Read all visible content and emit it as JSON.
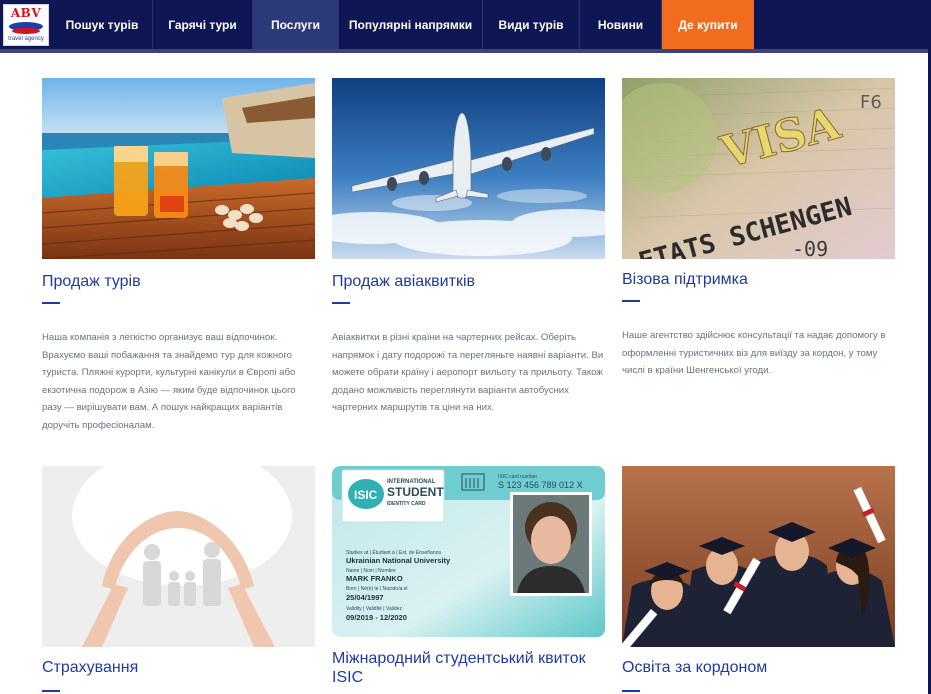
{
  "logo": {
    "text": "ABV",
    "subtext": "travel agency"
  },
  "nav": {
    "items": [
      {
        "label": "Пошук турів"
      },
      {
        "label": "Гарячі тури"
      },
      {
        "label": "Послуги"
      },
      {
        "label": "Популярні напрямки"
      },
      {
        "label": "Види турів"
      },
      {
        "label": "Новини"
      },
      {
        "label": "Де купити"
      }
    ]
  },
  "cards": [
    {
      "title": "Продаж турів",
      "description": "Наша компанія з легкістю организує ваш відпочинок. Врахуємо ваші побажання та знайдемо тур для кожного туриста. Пляжні курорти, культурні канікули в Європі або екзотична подорож в Азію — яким буде відпочинок цього разу — вирішувати вам. А пошук найкращих варіантів доручіть професіоналам."
    },
    {
      "title": "Продаж авіаквитків",
      "description": "Авіаквитки в різні країни на чартерних рейсах. Оберіть напрямок і дату подорожі та перегляньте наявні варіанти. Ви можете обрати країну і аеропорт вильоту та прильоту. Також додано можливість переглянути варіанти автобусних чартерних маршрутів та ціни на них."
    },
    {
      "title": "Візова підтримка",
      "description": "Наше агентство здійснює консультації та надає допомогу в оформленні туристичних віз для виїзду за кордон, у тому числі в країни Шенгенської угоди."
    },
    {
      "title": "Страхування"
    },
    {
      "title": "Міжнародний студентський квиток",
      "subtitle": "ISIC"
    },
    {
      "title": "Освіта за кордоном"
    }
  ],
  "visa_image": {
    "line1": "VISA",
    "line2": "ETATS SCHENGEN",
    "line3": "-09",
    "corner": "F6"
  },
  "isic_card": {
    "badge": "ISIC",
    "brand_line1": "INTERNATIONAL",
    "brand_line2": "STUDENT",
    "brand_line3": "IDENTITY CARD",
    "card_number_label": "ISIC card number",
    "card_number": "S 123 456 789 012 X",
    "studies_label": "Studies at | Étudiant à | Est. de Enseñanza",
    "university": "Ukrainian National University",
    "name_label": "Name | Nom | Nombre",
    "name": "MARK FRANKO",
    "born_label": "Born | Né(e) le | Nacido/a el",
    "born": "25/04/1997",
    "validity_label": "Validity | Validité | Validez",
    "validity": "09/2019 - 12/2020"
  },
  "colors": {
    "nav_bg": "#0e1653",
    "nav_active": "#2d3a7a",
    "cta": "#f26c1f",
    "title_blue": "#1f3aa0",
    "text_gray": "#6a7280"
  }
}
